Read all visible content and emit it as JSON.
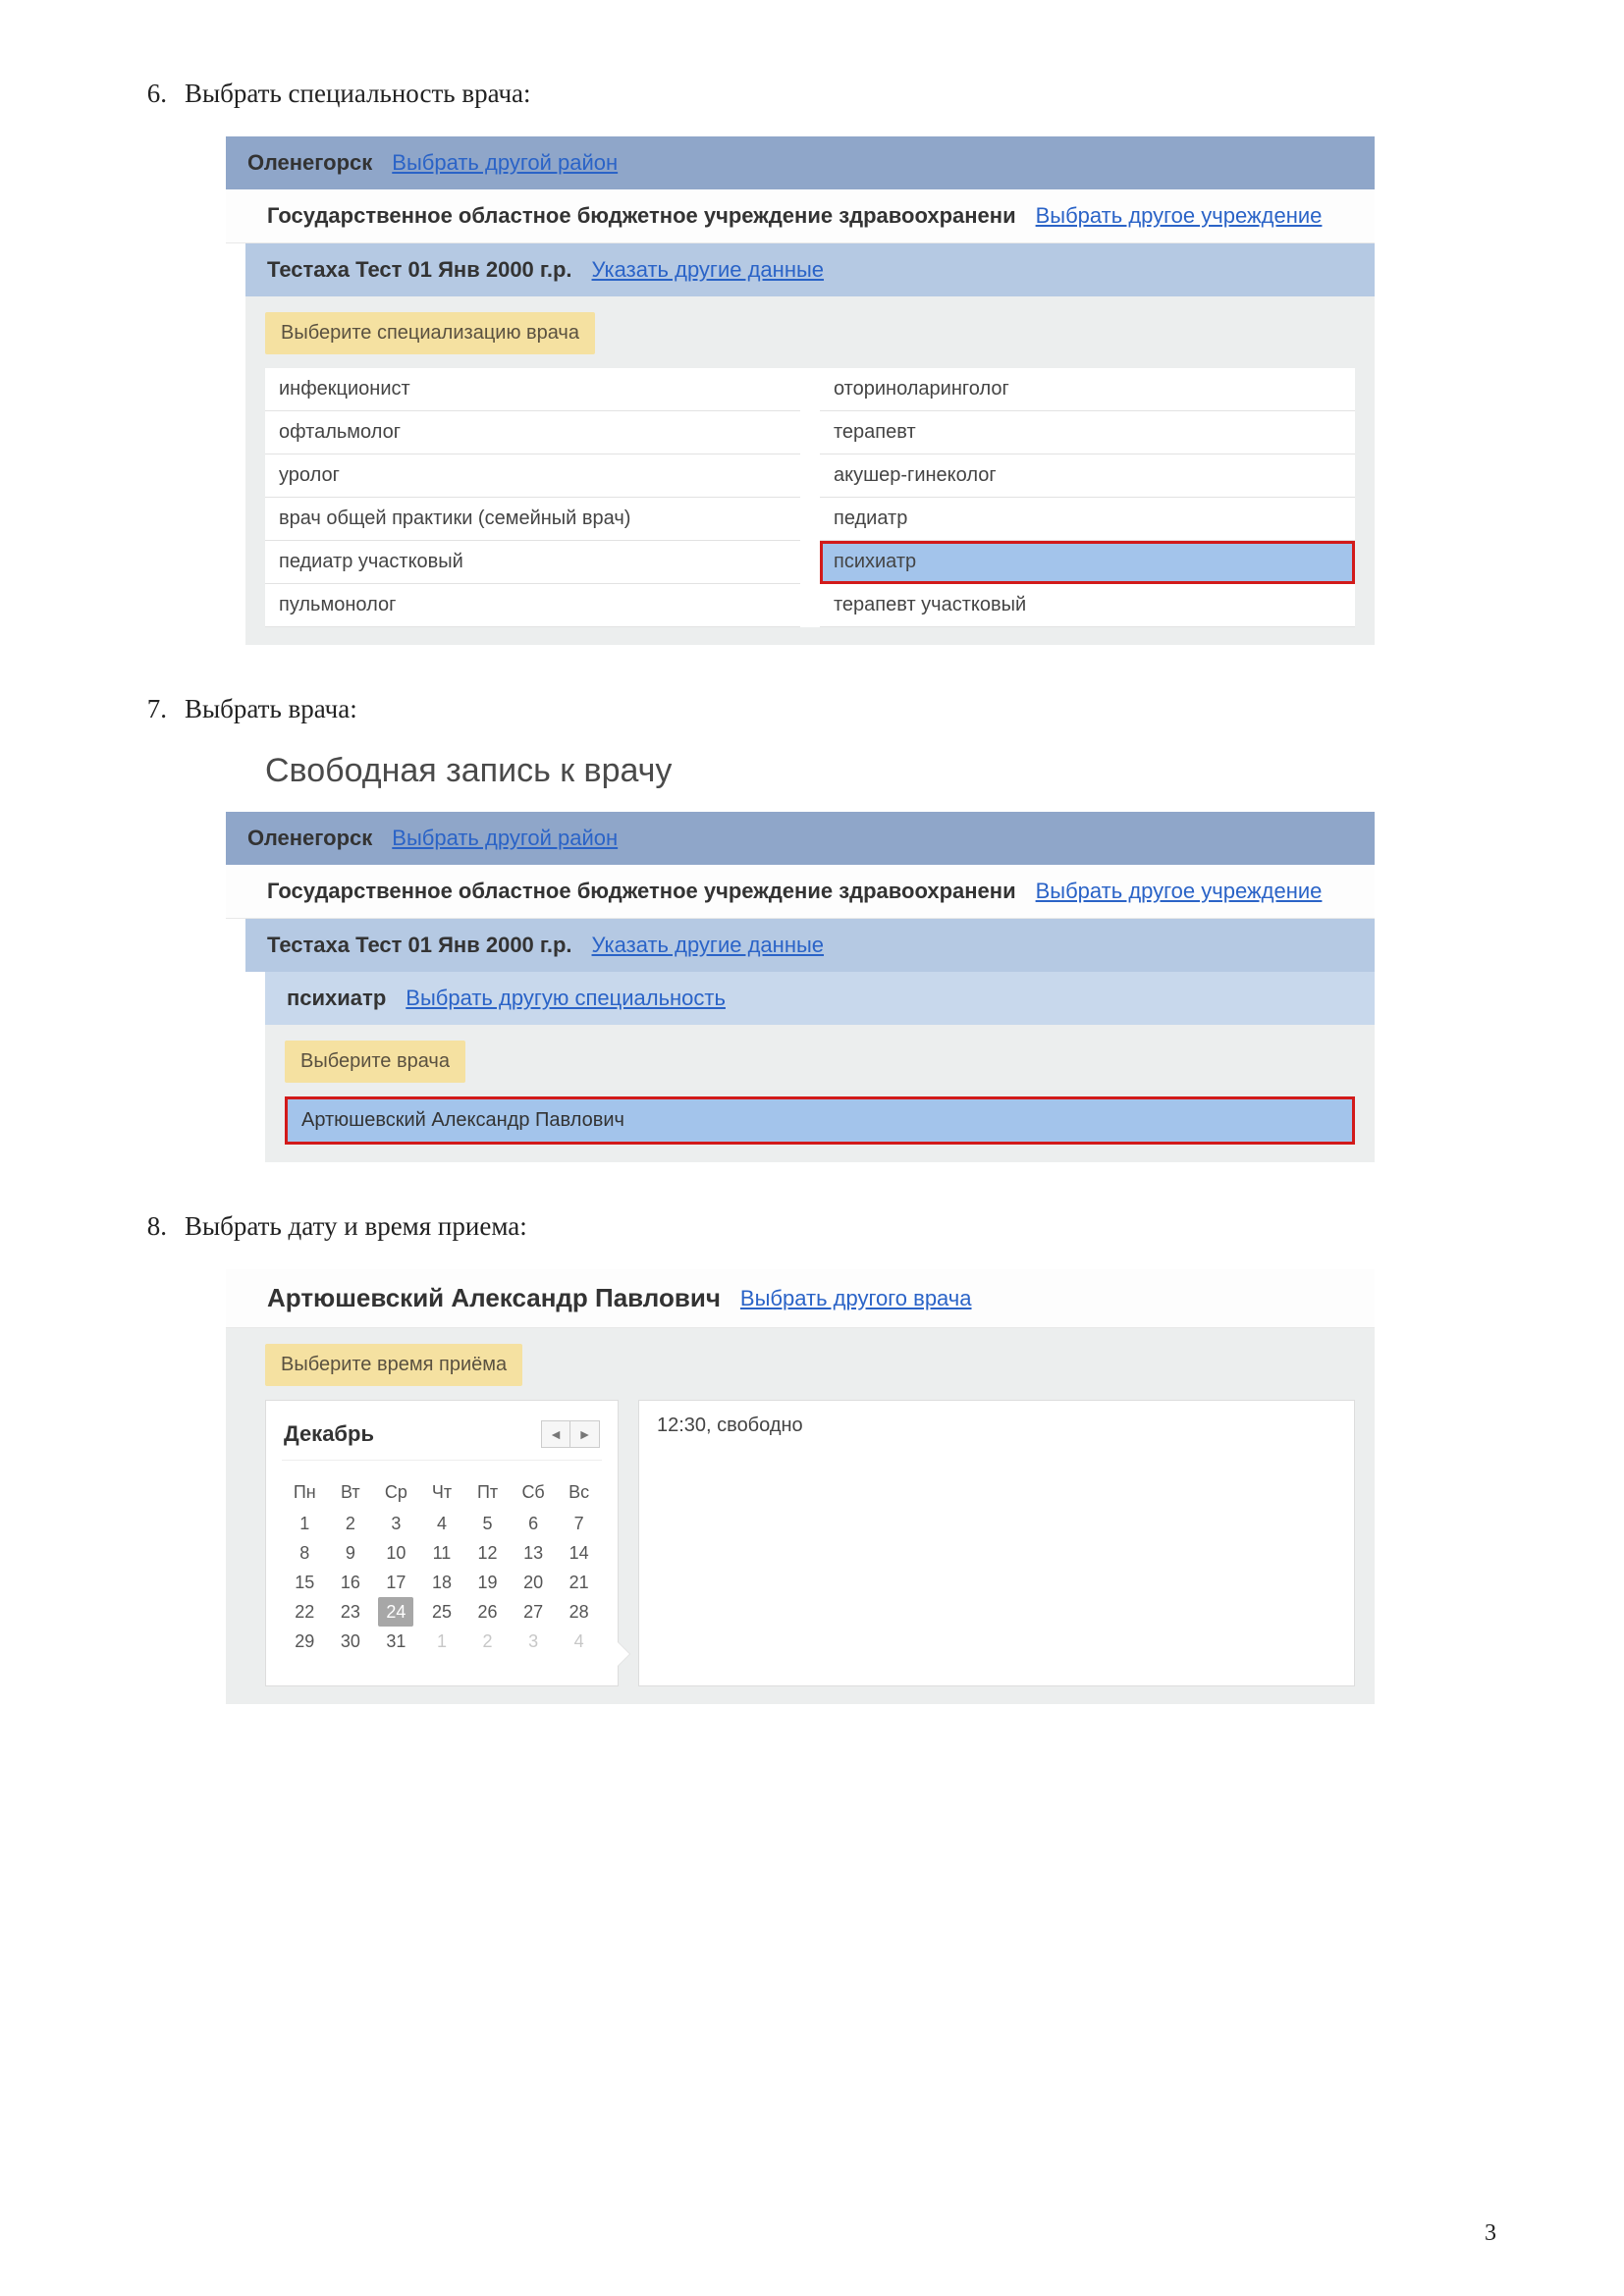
{
  "page_number": "3",
  "steps": {
    "s6": {
      "num": "6.",
      "title": "Выбрать специальность врача:"
    },
    "s7": {
      "num": "7.",
      "title": "Выбрать врача:"
    },
    "s8": {
      "num": "8.",
      "title": "Выбрать дату и время приема:"
    }
  },
  "common": {
    "district": "Оленегорск",
    "district_link": "Выбрать другой район",
    "institution": "Государственное областное бюджетное учреждение здравоохранени",
    "institution_link": "Выбрать другое учреждение",
    "patient": "Тестаха Тест 01 Янв 2000 г.р.",
    "patient_link": "Указать другие данные"
  },
  "specialty": {
    "chip": "Выберите специализацию врача",
    "left": [
      "инфекционист",
      "офтальмолог",
      "уролог",
      "врач общей практики (семейный врач)",
      "педиатр участковый",
      "пульмонолог"
    ],
    "right": [
      "оториноларинголог",
      "терапевт",
      "акушер-гинеколог",
      "педиатр",
      "психиатр",
      "терапевт участковый"
    ],
    "highlight_index_right": 4
  },
  "doctor_page": {
    "heading": "Свободная запись к врачу",
    "specialty": "психиатр",
    "specialty_link": "Выбрать другую специальность",
    "chip": "Выберите врача",
    "doctor": "Артюшевский Александр Павлович"
  },
  "time_page": {
    "doctor": "Артюшевский Александр Павлович",
    "doctor_link": "Выбрать другого врача",
    "chip": "Выберите время приёма",
    "month": "Декабрь",
    "dow": [
      "Пн",
      "Вт",
      "Ср",
      "Чт",
      "Пт",
      "Сб",
      "Вс"
    ],
    "weeks": [
      [
        {
          "d": "1"
        },
        {
          "d": "2"
        },
        {
          "d": "3"
        },
        {
          "d": "4"
        },
        {
          "d": "5"
        },
        {
          "d": "6"
        },
        {
          "d": "7"
        }
      ],
      [
        {
          "d": "8"
        },
        {
          "d": "9"
        },
        {
          "d": "10"
        },
        {
          "d": "11"
        },
        {
          "d": "12"
        },
        {
          "d": "13"
        },
        {
          "d": "14"
        }
      ],
      [
        {
          "d": "15"
        },
        {
          "d": "16"
        },
        {
          "d": "17"
        },
        {
          "d": "18"
        },
        {
          "d": "19"
        },
        {
          "d": "20"
        },
        {
          "d": "21"
        }
      ],
      [
        {
          "d": "22"
        },
        {
          "d": "23"
        },
        {
          "d": "24",
          "sel": true
        },
        {
          "d": "25"
        },
        {
          "d": "26"
        },
        {
          "d": "27"
        },
        {
          "d": "28"
        }
      ],
      [
        {
          "d": "29"
        },
        {
          "d": "30"
        },
        {
          "d": "31"
        },
        {
          "d": "1",
          "other": true
        },
        {
          "d": "2",
          "other": true
        },
        {
          "d": "3",
          "other": true
        },
        {
          "d": "4",
          "other": true
        }
      ]
    ],
    "slot": "12:30, свободно"
  }
}
